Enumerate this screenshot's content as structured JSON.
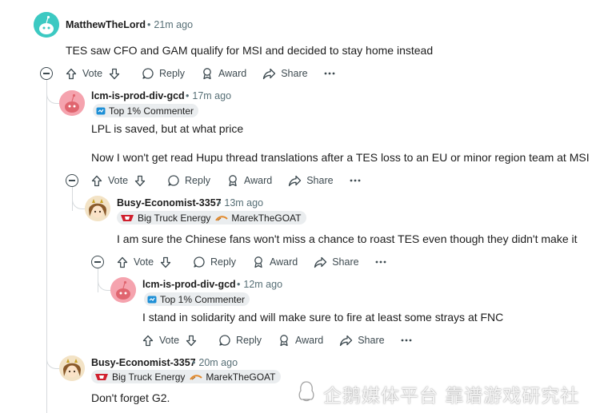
{
  "actions": {
    "vote": "Vote",
    "reply": "Reply",
    "award": "Award",
    "share": "Share"
  },
  "comments": [
    {
      "author": "MatthewTheLord",
      "time": "21m ago",
      "lines": [
        "TES saw CFO and GAM qualify for MSI and decided to stay home instead"
      ]
    },
    {
      "author": "lcm-is-prod-div-gcd",
      "time": "17m ago",
      "flair": "Top 1% Commenter",
      "lines": [
        "LPL is saved, but at what price",
        "Now I won't get read Hupu thread translations after a TES loss to an EU or minor region team at MSI"
      ]
    },
    {
      "author": "Busy-Economist-3357",
      "time": "13m ago",
      "flair_team": "Big Truck Energy",
      "flair_user": "MarekTheGOAT",
      "lines": [
        "I am sure the Chinese fans won't miss a chance to roast TES even though they didn't make it"
      ]
    },
    {
      "author": "lcm-is-prod-div-gcd",
      "time": "12m ago",
      "flair": "Top 1% Commenter",
      "lines": [
        "I stand in solidarity and will make sure to fire at least some strays at FNC"
      ]
    },
    {
      "author": "Busy-Economist-3357",
      "time": "20m ago",
      "flair_team": "Big Truck Energy",
      "flair_user": "MarekTheGOAT",
      "lines": [
        "Don't forget G2."
      ]
    }
  ],
  "watermark": "企鹅媒体平台 靠谱游戏研究社",
  "colors": {
    "meta": "#576f76",
    "flair_bg": "#eaedef",
    "thread_line": "#d6dadd",
    "avatar_teal": "#3cc9c2",
    "avatar_pink": "#f5a3ae"
  }
}
